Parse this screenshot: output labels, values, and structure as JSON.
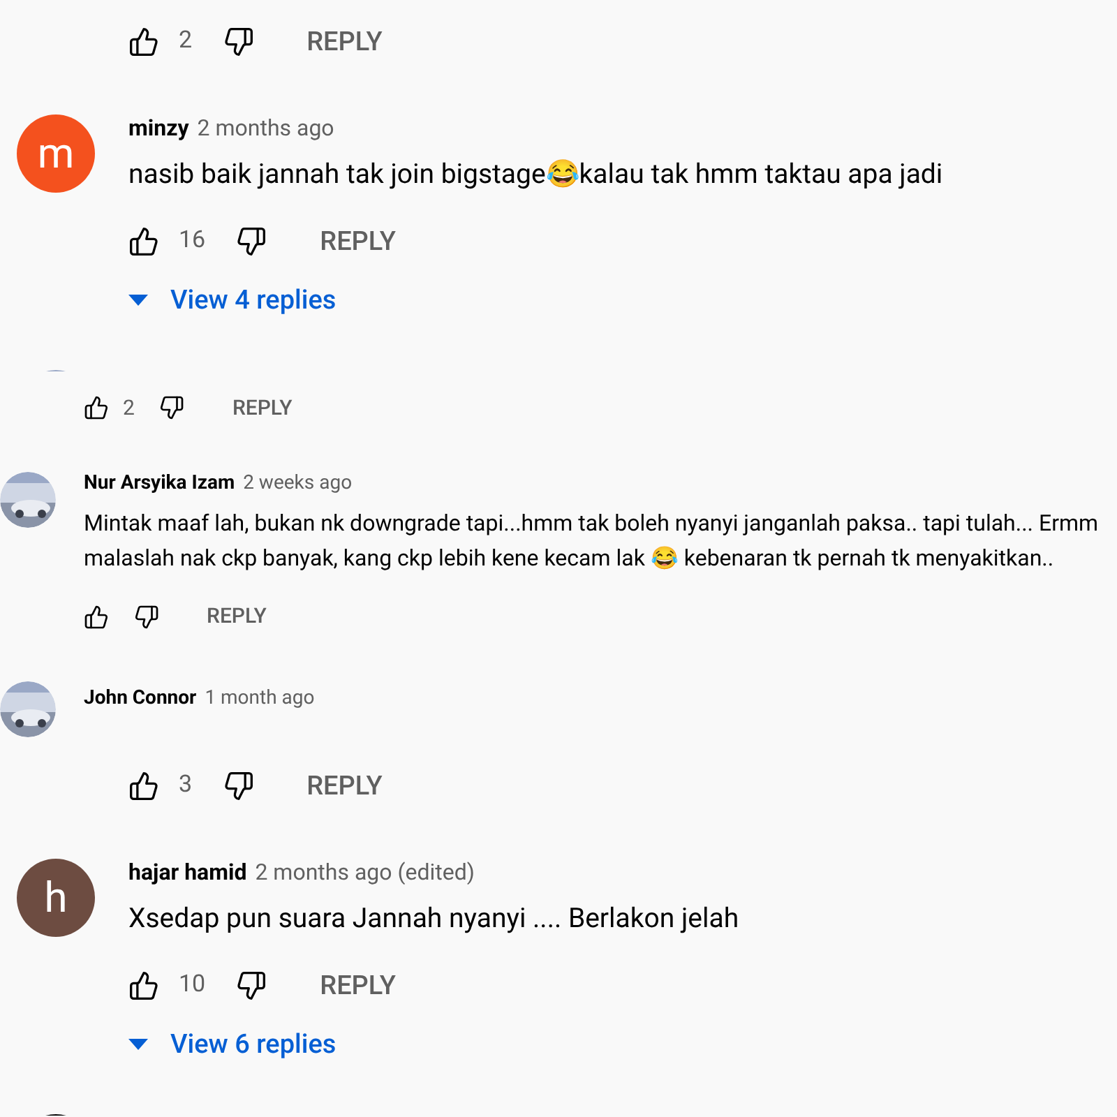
{
  "panels": [
    {
      "kind": "large",
      "items": [
        {
          "kind": "actions",
          "likes": "2",
          "reply": "REPLY"
        },
        {
          "kind": "comment",
          "author": "minzy",
          "time": "2 months ago",
          "text": "nasib baik jannah tak join bigstage😂kalau tak hmm taktau apa jadi",
          "avatar": {
            "kind": "letter",
            "letter": "m",
            "color": "#f4511e"
          },
          "likes": "16",
          "reply": "REPLY"
        },
        {
          "kind": "replies",
          "label": "View 4 replies"
        },
        {
          "kind": "cut"
        }
      ]
    },
    {
      "kind": "small",
      "items": [
        {
          "kind": "actions",
          "likes": "2",
          "reply": "REPLY"
        },
        {
          "kind": "comment",
          "author": "Nur Arsyika Izam",
          "time": "2 weeks ago",
          "text": "Mintak maaf lah, bukan nk downgrade tapi...hmm tak boleh nyanyi janganlah paksa.. tapi tulah... Ermm malaslah nak ckp banyak, kang ckp lebih kene kecam lak 😂 kebenaran tk pernah tk menyakitkan..",
          "reply": "REPLY"
        },
        {
          "kind": "header",
          "author": "John Connor",
          "time": "1 month ago"
        }
      ]
    },
    {
      "kind": "large",
      "items": [
        {
          "kind": "actions",
          "likes": "3",
          "reply": "REPLY"
        },
        {
          "kind": "comment",
          "author": "hajar hamid",
          "time": "2 months ago (edited)",
          "text": "Xsedap pun suara Jannah nyanyi .... Berlakon jelah",
          "avatar": {
            "kind": "letter",
            "letter": "h",
            "color": "#6d4c41"
          },
          "likes": "10",
          "reply": "REPLY"
        },
        {
          "kind": "replies",
          "label": "View 6 replies"
        },
        {
          "kind": "cut",
          "avatar": {
            "kind": "plain",
            "color": "#000000"
          }
        }
      ]
    }
  ]
}
